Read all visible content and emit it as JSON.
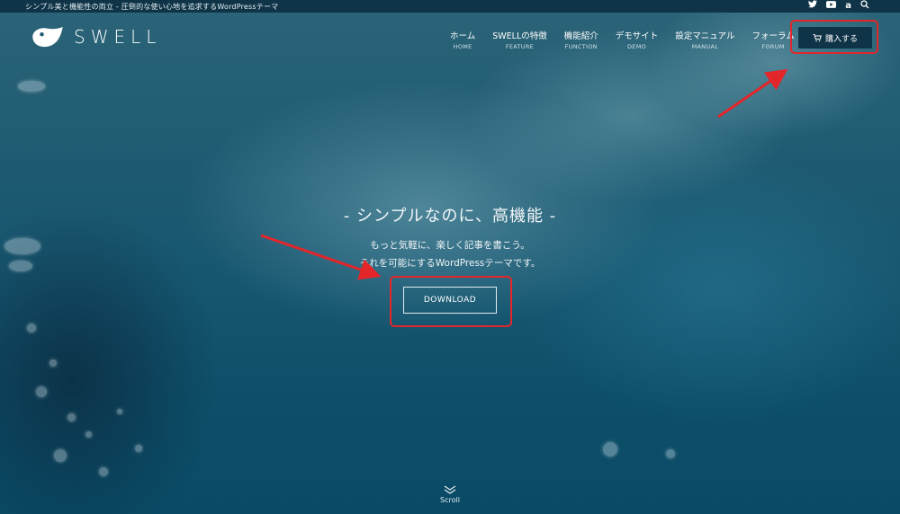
{
  "topbar": {
    "tagline": "シンプル美と機能性の両立 - 圧倒的な使い心地を追求するWordPressテーマ",
    "icons": [
      "twitter-icon",
      "youtube-icon",
      "amazon-icon",
      "search-icon"
    ]
  },
  "logo": {
    "text": "SWELL"
  },
  "nav": {
    "items": [
      {
        "jp": "ホーム",
        "en": "HOME"
      },
      {
        "jp": "SWELLの特徴",
        "en": "FEATURE"
      },
      {
        "jp": "機能紹介",
        "en": "FUNCTION"
      },
      {
        "jp": "デモサイト",
        "en": "DEMO"
      },
      {
        "jp": "設定マニュアル",
        "en": "MANUAL"
      },
      {
        "jp": "フォーラム",
        "en": "FORUM"
      }
    ],
    "buy_label": "購入する"
  },
  "hero": {
    "catch": "- シンプルなのに、高機能 -",
    "sub1": "もっと気軽に、楽しく記事を書こう。",
    "sub2": "それを可能にするWordPressテーマです。",
    "download_label": "DOWNLOAD",
    "scroll_label": "Scroll"
  },
  "colors": {
    "accent_red": "#e3262a",
    "header_bg": "#0f3447"
  }
}
